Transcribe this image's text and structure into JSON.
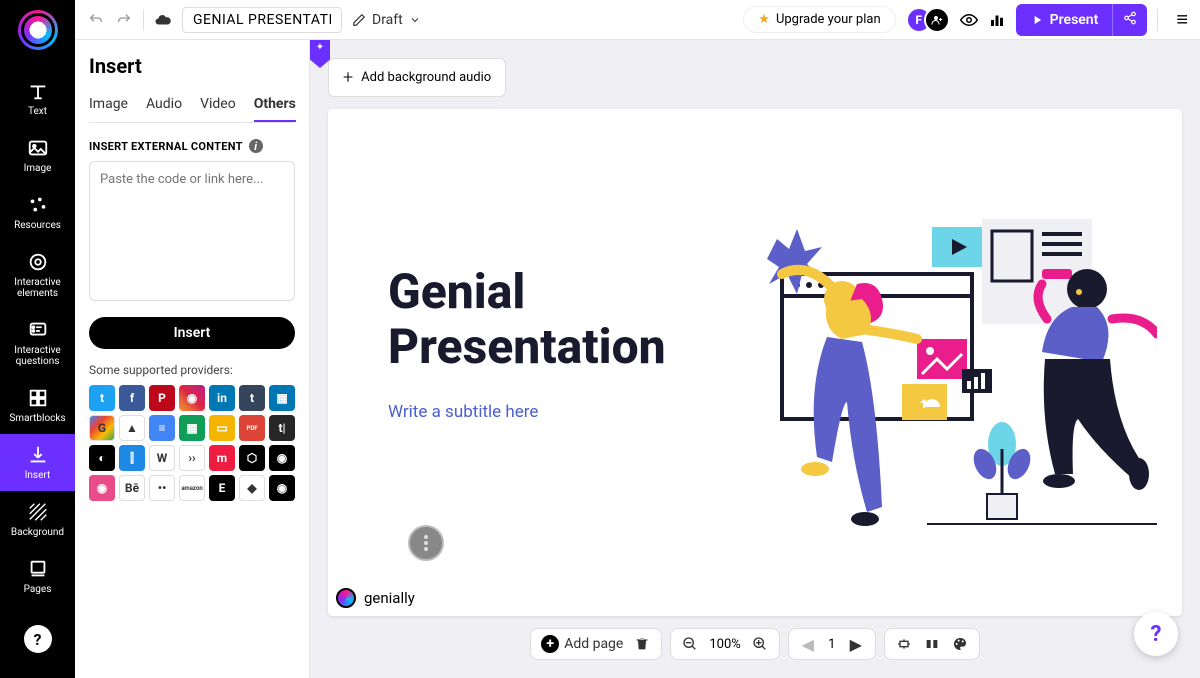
{
  "topbar": {
    "title": "GENIAL PRESENTATION",
    "status": "Draft",
    "upgrade": "Upgrade your plan",
    "present": "Present",
    "avatar_initial": "F"
  },
  "sidebar": {
    "items": [
      {
        "label": "Text"
      },
      {
        "label": "Image"
      },
      {
        "label": "Resources"
      },
      {
        "label": "Interactive elements"
      },
      {
        "label": "Interactive questions"
      },
      {
        "label": "Smartblocks"
      },
      {
        "label": "Insert"
      },
      {
        "label": "Background"
      },
      {
        "label": "Pages"
      }
    ]
  },
  "panel": {
    "title": "Insert",
    "tabs": [
      "Image",
      "Audio",
      "Video",
      "Others"
    ],
    "active_tab": 3,
    "section_label": "INSERT EXTERNAL CONTENT",
    "placeholder": "Paste the code or link here...",
    "button": "Insert",
    "providers_label": "Some supported providers:",
    "providers": [
      {
        "name": "twitter",
        "bg": "#1da1f2",
        "txt": "t"
      },
      {
        "name": "facebook",
        "bg": "#3b5998",
        "txt": "f"
      },
      {
        "name": "pinterest",
        "bg": "#bd081c",
        "txt": "P"
      },
      {
        "name": "instagram",
        "bg": "linear-gradient(45deg,#f09433,#e6683c,#dc2743,#cc2366,#bc1888)",
        "txt": "◉"
      },
      {
        "name": "linkedin",
        "bg": "#0077b5",
        "txt": "in"
      },
      {
        "name": "tumblr",
        "bg": "#35465c",
        "txt": "t"
      },
      {
        "name": "slideshare",
        "bg": "#0077b5",
        "txt": "▦"
      },
      {
        "name": "gmaps",
        "bg": "linear-gradient(135deg,#4285f4,#ea4335,#fbbc05,#34a853)",
        "txt": "G"
      },
      {
        "name": "gdrive",
        "bg": "#fff",
        "txt": "▲"
      },
      {
        "name": "gdocs",
        "bg": "#4285f4",
        "txt": "≡"
      },
      {
        "name": "gsheets",
        "bg": "#0f9d58",
        "txt": "▦"
      },
      {
        "name": "gslides",
        "bg": "#f4b400",
        "txt": "▭"
      },
      {
        "name": "pdf",
        "bg": "#db4437",
        "txt": "PDF"
      },
      {
        "name": "typeform",
        "bg": "#262627",
        "txt": "t|"
      },
      {
        "name": "mailchimp",
        "bg": "#000",
        "txt": "◐"
      },
      {
        "name": "amplitude",
        "bg": "#1e88e5",
        "txt": "⫿"
      },
      {
        "name": "wikipedia",
        "bg": "#fff",
        "txt": "W"
      },
      {
        "name": "issuu",
        "bg": "#fff",
        "txt": "››"
      },
      {
        "name": "meetup",
        "bg": "#ed1c40",
        "txt": "m"
      },
      {
        "name": "codepen",
        "bg": "#000",
        "txt": "⬡"
      },
      {
        "name": "github",
        "bg": "#000",
        "txt": "◉"
      },
      {
        "name": "dribbble",
        "bg": "#ea4c89",
        "txt": "◉"
      },
      {
        "name": "behance",
        "bg": "#fff",
        "txt": "Bē"
      },
      {
        "name": "flickr",
        "bg": "#fff",
        "txt": "••"
      },
      {
        "name": "amazon",
        "bg": "#fff",
        "txt": "amazon"
      },
      {
        "name": "eventbrite",
        "bg": "#000",
        "txt": "E"
      },
      {
        "name": "sketchfab",
        "bg": "#fff",
        "txt": "◆"
      },
      {
        "name": "spotify",
        "bg": "#000",
        "txt": "◉"
      }
    ]
  },
  "canvas": {
    "audio_btn": "Add background audio",
    "slide_title_1": "Genial",
    "slide_title_2": "Presentation",
    "slide_subtitle": "Write a subtitle here",
    "badge": "genially"
  },
  "bottombar": {
    "add_page": "Add page",
    "zoom": "100%",
    "page_num": "1"
  }
}
